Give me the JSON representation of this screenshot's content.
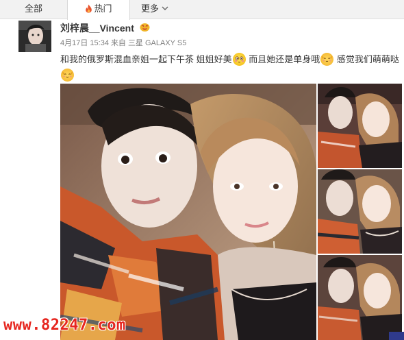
{
  "tabs": {
    "all": "全部",
    "hot": "热门",
    "more": "更多"
  },
  "post": {
    "username": "刘梓晨__Vincent",
    "date": "4月17日 15:34",
    "source_prefix": "来自",
    "device": "三星 GALAXY S5",
    "text_1": "和我的俄罗斯混血亲姐一起下午茶 姐姐好美",
    "text_2": " 而且她还是单身哦",
    "text_3": " 感觉我们萌萌哒"
  },
  "icons": {
    "hot_tab": "flame-icon",
    "more_tab": "chevron-down-icon",
    "badge": "vip-badge-icon",
    "emoji_1": "blush-face-emoji",
    "emoji_2": "cat-face-emoji",
    "emoji_3": "cat-face-emoji"
  },
  "photos": [
    {
      "name": "main-photo",
      "alt": ""
    },
    {
      "name": "thumb-1",
      "alt": ""
    },
    {
      "name": "thumb-2",
      "alt": ""
    },
    {
      "name": "thumb-3",
      "alt": ""
    }
  ],
  "watermark": {
    "site": "www.82247.com"
  },
  "colors": {
    "tab_bg": "#f2f2f2",
    "active_tab_bg": "#ffffff",
    "hot_icon": "#e8532d",
    "text": "#333333",
    "meta_text": "#808080",
    "watermark": "#e6261f"
  }
}
